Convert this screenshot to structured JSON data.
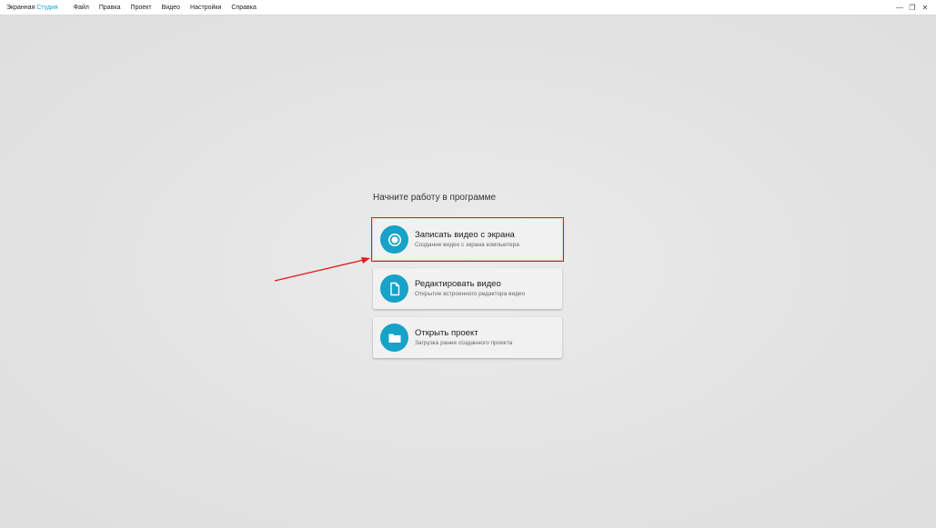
{
  "app": {
    "name_part1": "Экранная",
    "name_part2": "Студия"
  },
  "menu": [
    "Файл",
    "Правка",
    "Проект",
    "Видео",
    "Настройки",
    "Справка"
  ],
  "window_controls": {
    "minimize": "—",
    "maximize": "❐",
    "close": "✕"
  },
  "start": {
    "heading": "Начните работу в программе",
    "cards": [
      {
        "title": "Записать видео с экрана",
        "subtitle": "Создание видео с экрана компьютера",
        "icon": "record-icon"
      },
      {
        "title": "Редактировать видео",
        "subtitle": "Открытие встроенного редактора видео",
        "icon": "document-icon"
      },
      {
        "title": "Открыть проект",
        "subtitle": "Загрузка ранее созданного проекта",
        "icon": "folder-icon"
      }
    ]
  },
  "colors": {
    "accent": "#17a2c8",
    "highlight": "#e31b1b",
    "background": "#e4e4e4"
  }
}
